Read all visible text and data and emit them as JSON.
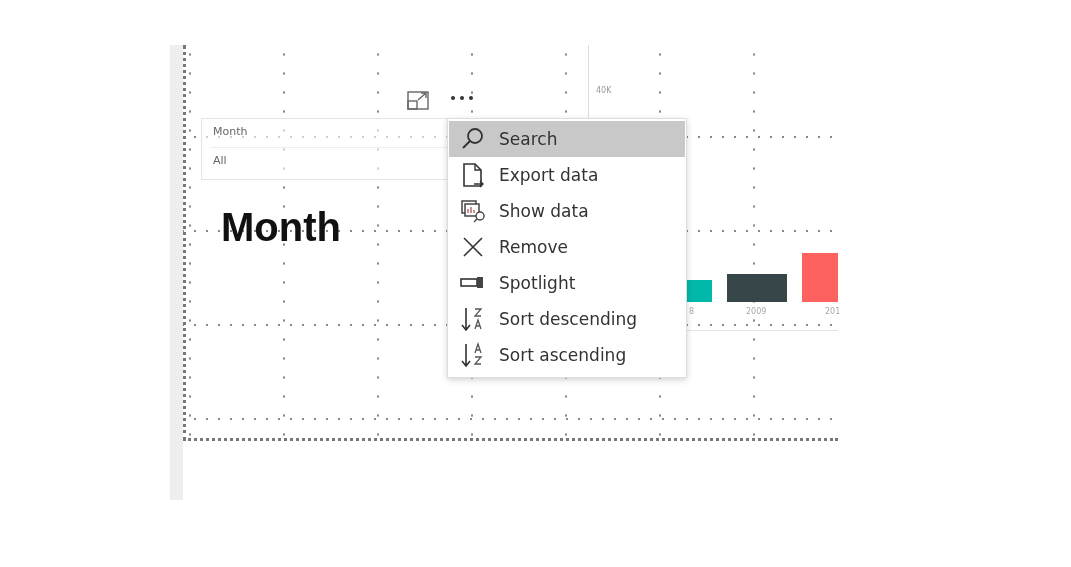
{
  "slicer": {
    "title": "Month",
    "value": "All"
  },
  "card": {
    "text": "Month"
  },
  "chart": {
    "y_tick": "40K",
    "x_labels": [
      "8",
      "2009",
      "201"
    ],
    "bars": [
      {
        "color": "#01b8aa"
      },
      {
        "color": "#374649"
      },
      {
        "color": "#fd625e"
      }
    ]
  },
  "menu": [
    {
      "kind": "search",
      "label": "Search",
      "selected": true
    },
    {
      "kind": "export",
      "label": "Export data",
      "selected": false
    },
    {
      "kind": "show",
      "label": "Show data",
      "selected": false
    },
    {
      "kind": "remove",
      "label": "Remove",
      "selected": false
    },
    {
      "kind": "spotlight",
      "label": "Spotlight",
      "selected": false
    },
    {
      "kind": "sortdesc",
      "label": "Sort descending",
      "selected": false
    },
    {
      "kind": "sortasc",
      "label": "Sort ascending",
      "selected": false
    }
  ]
}
